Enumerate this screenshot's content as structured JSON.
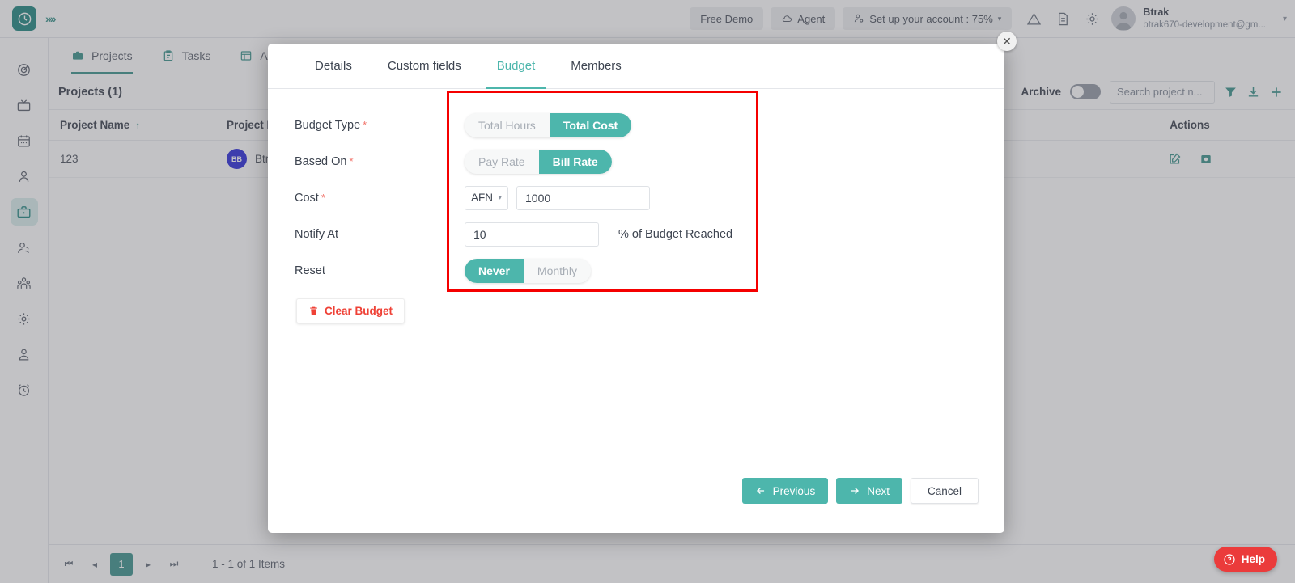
{
  "colors": {
    "teal": "#4db6ac",
    "dark_teal": "#0f7d75",
    "red_highlight": "#f50000",
    "danger": "#ef4136",
    "help_red": "#eb3b3b",
    "avatar_blue": "#1a1ad6"
  },
  "topbar": {
    "logo_icon": "clock-icon",
    "expander_icon": "chevron-triple-right-icon",
    "free_demo": "Free Demo",
    "agent": "Agent",
    "agent_icon": "cloud-icon",
    "setup_account": "Set up your account : 75%",
    "setup_icon": "user-gear-icon",
    "setup_caret": "▾",
    "warning_icon": "warning-triangle-icon",
    "document_icon": "document-icon",
    "settings_icon": "gear-icon",
    "user_name": "Btrak",
    "user_email": "btrak670-development@gm...",
    "user_caret": "▾"
  },
  "rail": {
    "items": [
      {
        "name": "sidebar-item-tracker",
        "icon": "target-icon",
        "active": false
      },
      {
        "name": "sidebar-item-screens",
        "icon": "tv-icon",
        "active": false
      },
      {
        "name": "sidebar-item-calendar",
        "icon": "calendar-icon",
        "active": false
      },
      {
        "name": "sidebar-item-person",
        "icon": "user-icon",
        "active": false
      },
      {
        "name": "sidebar-item-projects",
        "icon": "briefcase-icon",
        "active": true
      },
      {
        "name": "sidebar-item-clients",
        "icon": "user-plus-icon",
        "active": false
      },
      {
        "name": "sidebar-item-teams",
        "icon": "group-icon",
        "active": false
      },
      {
        "name": "sidebar-item-settings",
        "icon": "gear-icon",
        "active": false
      },
      {
        "name": "sidebar-item-employee",
        "icon": "user-badge-icon",
        "active": false
      },
      {
        "name": "sidebar-item-timesheet",
        "icon": "alarm-clock-icon",
        "active": false
      }
    ]
  },
  "nav_tabs": [
    {
      "label": "Projects",
      "icon": "briefcase-icon",
      "active": true
    },
    {
      "label": "Tasks",
      "icon": "clipboard-icon",
      "active": false
    },
    {
      "label": "Ac",
      "icon": "table-icon",
      "active": false
    }
  ],
  "panel": {
    "title": "Projects (1)",
    "archive_label": "Archive",
    "archive_on": false,
    "search_placeholder": "Search project n...",
    "filter_icon": "funnel-icon",
    "download_icon": "download-icon",
    "add_icon": "plus-icon"
  },
  "grid": {
    "columns": [
      "Project Name",
      "Project R",
      "Actions"
    ],
    "sort_indicator": "↑",
    "rows": [
      {
        "project_name": "123",
        "owner_initials": "BB",
        "owner_name": "Btro",
        "action_icons": [
          "edit-icon",
          "archive-icon"
        ]
      }
    ]
  },
  "pager": {
    "first_icon": "⏮",
    "prev_icon": "◂",
    "page": "1",
    "next_icon": "▸",
    "last_icon": "⏭",
    "summary": "1 - 1 of 1 Items"
  },
  "help": {
    "label": "Help",
    "icon": "question-circle-icon"
  },
  "modal": {
    "close_icon": "close-icon",
    "tabs": [
      {
        "label": "Details",
        "active": false
      },
      {
        "label": "Custom fields",
        "active": false
      },
      {
        "label": "Budget",
        "active": true
      },
      {
        "label": "Members",
        "active": false
      }
    ],
    "fields": {
      "budget_type": {
        "label": "Budget Type",
        "required": true,
        "options": [
          "Total Hours",
          "Total Cost"
        ],
        "selected": "Total Cost"
      },
      "based_on": {
        "label": "Based On",
        "required": true,
        "options": [
          "Pay Rate",
          "Bill Rate"
        ],
        "selected": "Bill Rate"
      },
      "cost": {
        "label": "Cost",
        "required": true,
        "currency": "AFN",
        "currency_caret": "▾",
        "value": "1000"
      },
      "notify_at": {
        "label": "Notify At",
        "required": false,
        "value": "10",
        "suffix": "% of Budget Reached"
      },
      "reset": {
        "label": "Reset",
        "required": false,
        "options": [
          "Never",
          "Monthly"
        ],
        "selected": "Never"
      }
    },
    "clear_budget": {
      "label": "Clear Budget",
      "icon": "trash-icon"
    },
    "footer": {
      "previous": "Previous",
      "previous_icon": "arrow-left-icon",
      "next": "Next",
      "next_icon": "arrow-right-icon",
      "cancel": "Cancel"
    }
  }
}
